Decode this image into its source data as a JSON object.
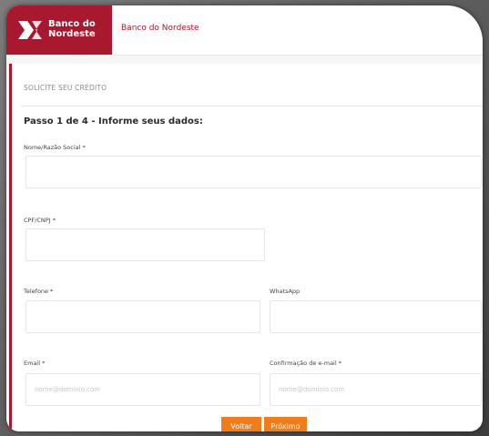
{
  "brand": {
    "logo_line1": "Banco do",
    "logo_line2": "Nordeste",
    "header_link": "Banco do Nordeste",
    "accent": "#a8182e",
    "button_color": "#f07c1b"
  },
  "form": {
    "section_title": "SOLICITE SEU CRÉDITO",
    "step_title": "Passo 1 de 4 - Informe seus dados:",
    "fields": {
      "nome": {
        "label": "Nome/Razão Social *",
        "value": "",
        "placeholder": ""
      },
      "cpf": {
        "label": "CPF/CNPJ *",
        "value": "",
        "placeholder": ""
      },
      "telefone": {
        "label": "Telefone *",
        "value": "",
        "placeholder": ""
      },
      "whatsapp": {
        "label": "WhatsApp",
        "value": "",
        "placeholder": ""
      },
      "email": {
        "label": "Email *",
        "value": "",
        "placeholder": "nome@dominio.com"
      },
      "email_confirm": {
        "label": "Confirmação de e-mail *",
        "value": "",
        "placeholder": "nome@dominio.com"
      }
    },
    "buttons": {
      "back": "Voltar",
      "next": "Próximo"
    }
  }
}
